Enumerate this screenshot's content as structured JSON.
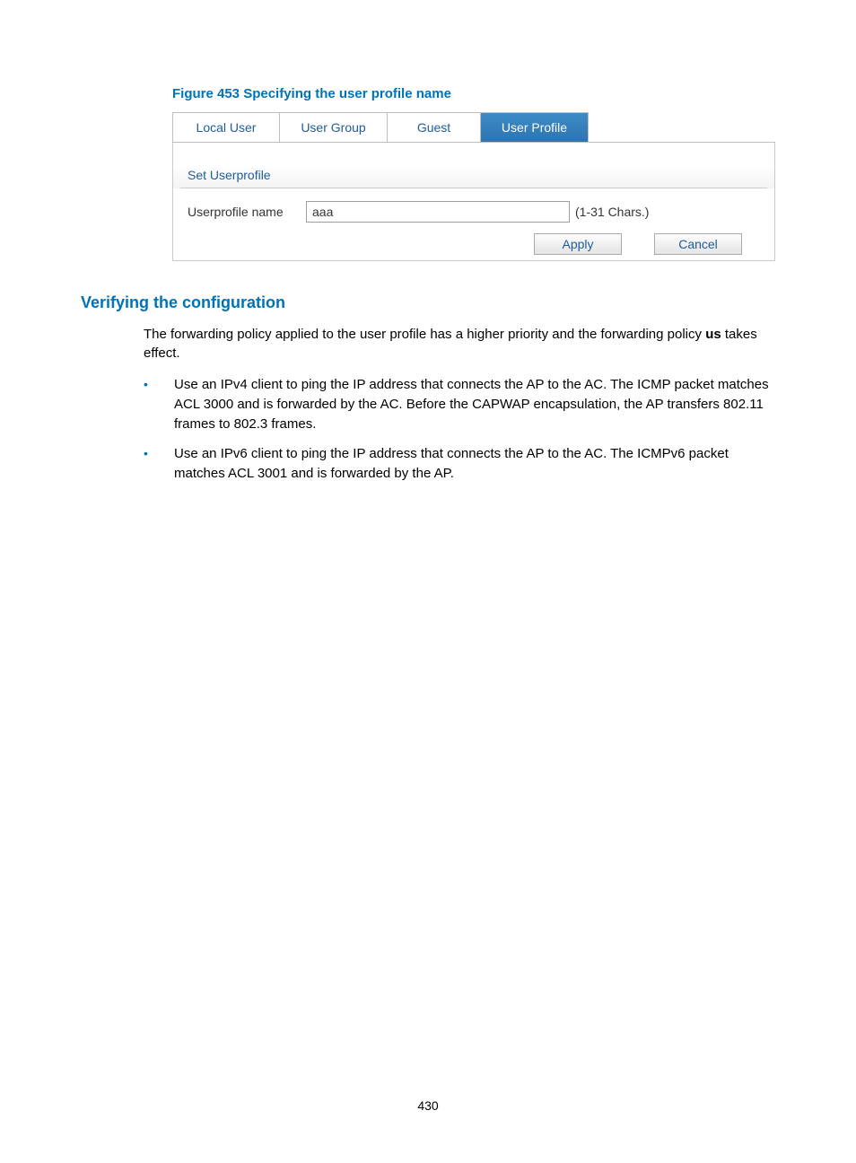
{
  "figure": {
    "caption": "Figure 453 Specifying the user profile name",
    "tabs": {
      "local_user": "Local User",
      "user_group": "User Group",
      "guest": "Guest",
      "user_profile": "User Profile"
    },
    "section_title": "Set Userprofile",
    "form": {
      "label": "Userprofile name",
      "value": "aaa",
      "hint": "(1-31 Chars.)"
    },
    "buttons": {
      "apply": "Apply",
      "cancel": "Cancel"
    }
  },
  "section": {
    "heading": "Verifying the configuration",
    "paragraph_parts": {
      "p1a": "The forwarding policy applied to the user profile has a higher priority and the forwarding policy ",
      "p1b": "us",
      "p1c": " takes effect."
    },
    "bullets": [
      "Use an IPv4 client to ping the IP address that connects the AP to the AC. The ICMP packet matches ACL 3000 and is forwarded by the AC. Before the CAPWAP encapsulation, the AP transfers 802.11 frames to 802.3 frames.",
      "Use an IPv6 client to ping the IP address that connects the AP to the AC. The ICMPv6 packet matches ACL 3001 and is forwarded by the AP."
    ]
  },
  "page_number": "430"
}
